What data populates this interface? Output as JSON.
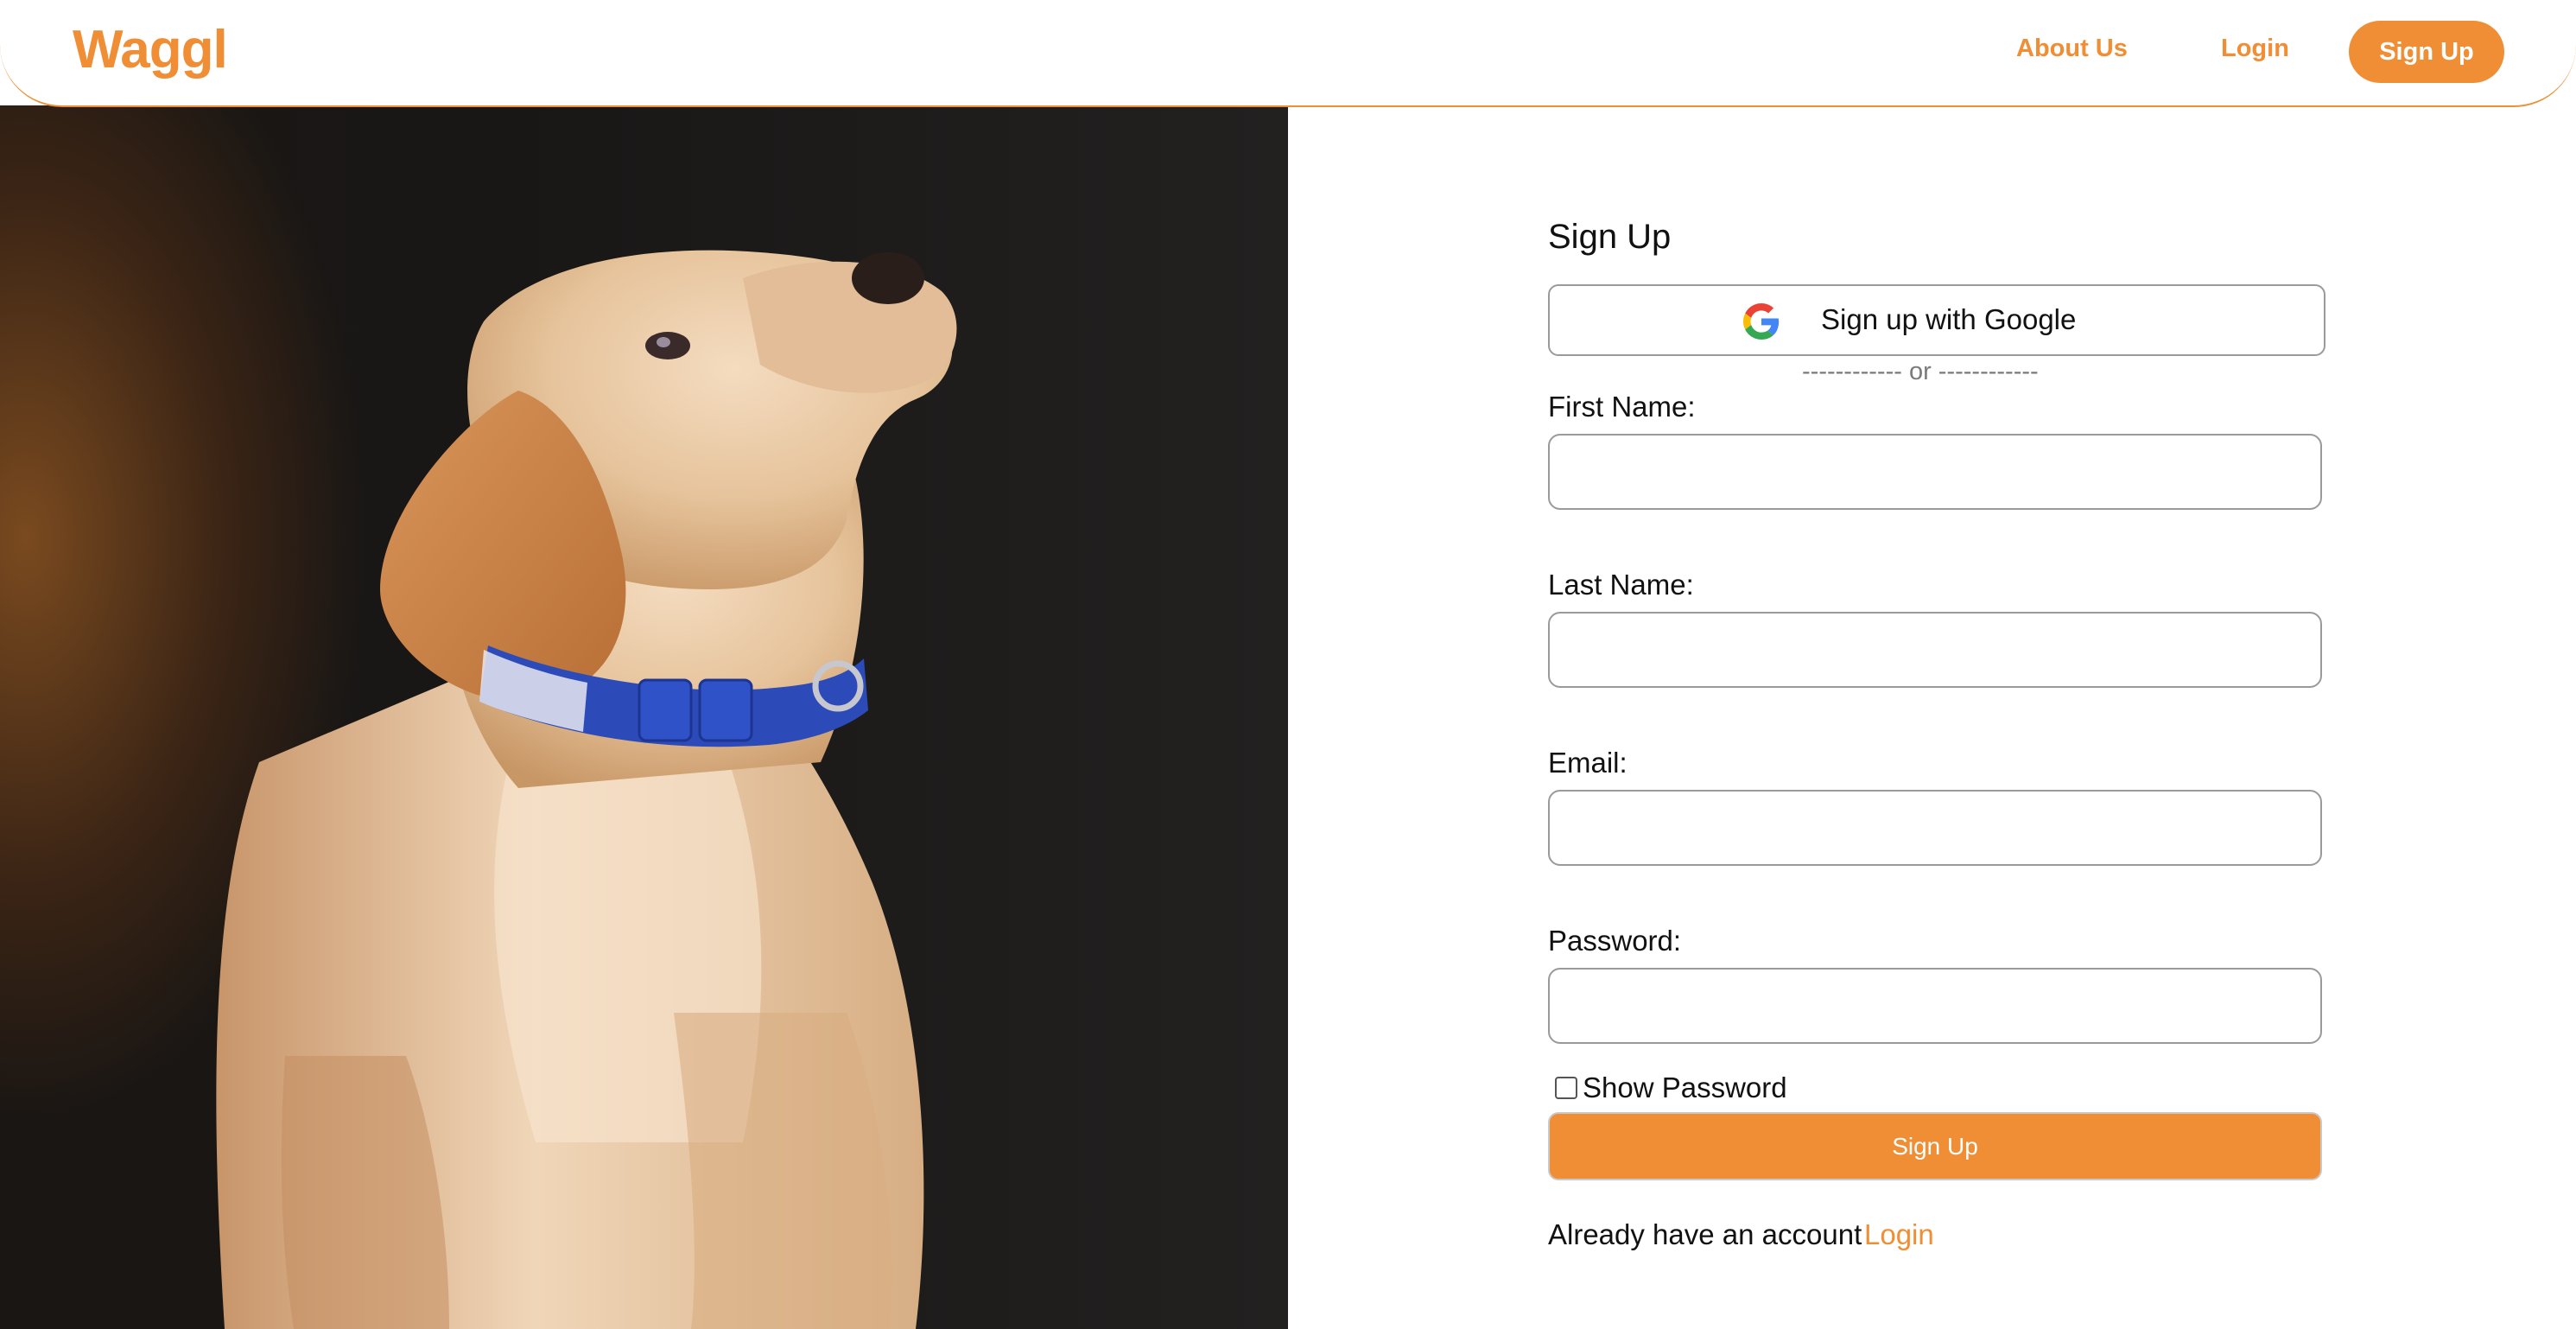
{
  "header": {
    "logo": "Waggl",
    "nav": {
      "about": "About Us",
      "login": "Login",
      "signup": "Sign Up"
    }
  },
  "hero_image": {
    "description_icon": "puppy-photo"
  },
  "form": {
    "title": "Sign Up",
    "google_button": "Sign up with Google",
    "divider": "------------ or ------------",
    "fields": {
      "first_name": {
        "label": "First Name:",
        "value": ""
      },
      "last_name": {
        "label": "Last Name:",
        "value": ""
      },
      "email": {
        "label": "Email:",
        "value": ""
      },
      "password": {
        "label": "Password:",
        "value": ""
      }
    },
    "show_password": {
      "label": "Show Password",
      "checked": false
    },
    "submit": "Sign Up",
    "footer": {
      "text": "Already have an account",
      "login_link": "Login"
    }
  },
  "colors": {
    "accent": "#ef8e35",
    "text": "#111111",
    "border": "#9a9a9a"
  }
}
